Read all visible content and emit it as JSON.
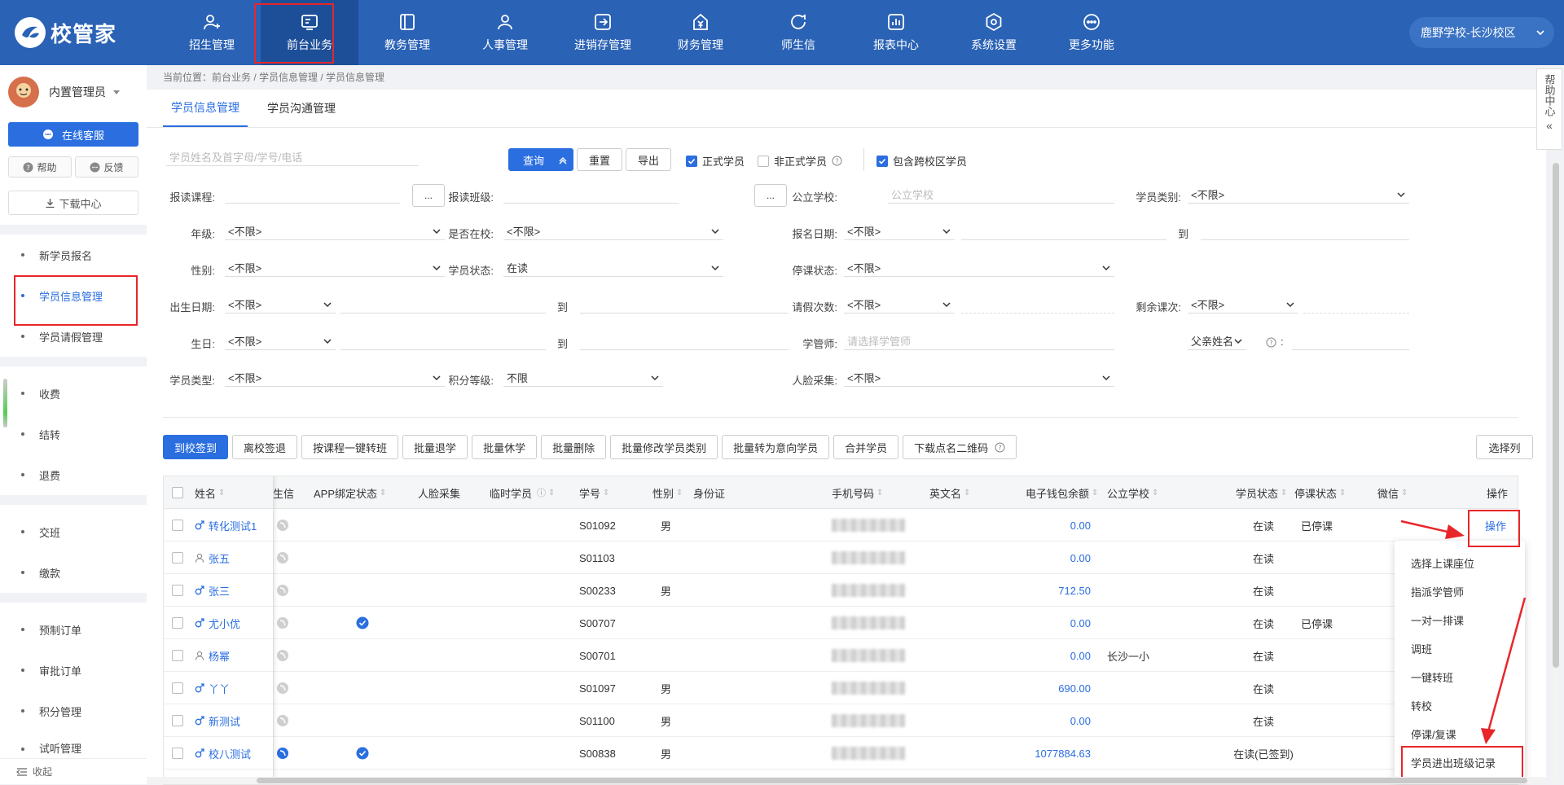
{
  "header": {
    "logo": "校管家",
    "nav": [
      {
        "label": "招生管理",
        "icon": "person-add-icon"
      },
      {
        "label": "前台业务",
        "icon": "frontdesk-icon"
      },
      {
        "label": "教务管理",
        "icon": "book-icon"
      },
      {
        "label": "人事管理",
        "icon": "person-icon"
      },
      {
        "label": "进销存管理",
        "icon": "inventory-icon"
      },
      {
        "label": "财务管理",
        "icon": "finance-icon"
      },
      {
        "label": "师生信",
        "icon": "message-icon"
      },
      {
        "label": "报表中心",
        "icon": "report-icon"
      },
      {
        "label": "系统设置",
        "icon": "settings-icon"
      },
      {
        "label": "更多功能",
        "icon": "more-icon"
      }
    ],
    "active_nav": "前台业务",
    "school": "鹿野学校-长沙校区"
  },
  "sidebar": {
    "user": "内置管理员",
    "service": "在线客服",
    "help": "帮助",
    "feedback": "反馈",
    "download": "下载中心",
    "items": [
      "新学员报名",
      "学员信息管理",
      "学员请假管理",
      "收费",
      "结转",
      "退费",
      "交班",
      "缴款",
      "预制订单",
      "审批订单",
      "积分管理",
      "试听管理"
    ],
    "collapse": "收起"
  },
  "breadcrumb": "当前位置：前台业务 / 学员信息管理 / 学员信息管理",
  "tabs": [
    "学员信息管理",
    "学员沟通管理"
  ],
  "search": {
    "placeholder": "学员姓名及首字母/学号/电话",
    "query": "查询",
    "reset": "重置",
    "export": "导出",
    "formal": "正式学员",
    "informal": "非正式学员",
    "cross_campus": "包含跨校区学员"
  },
  "filters": {
    "course_label": "报读课程:",
    "class_label": "报读班级:",
    "school_label": "公立学校:",
    "school_placeholder": "公立学校",
    "category_label": "学员类别:",
    "grade_label": "年级:",
    "in_school_label": "是否在校:",
    "signup_label": "报名日期:",
    "gender_label": "性别:",
    "status_label": "学员状态:",
    "status_value": "在读",
    "suspend_label": "停课状态:",
    "birthdate_label": "出生日期:",
    "leave_label": "请假次数:",
    "remain_label": "剩余课次:",
    "birthday_label": "生日:",
    "manager_label": "学管师:",
    "manager_placeholder": "请选择学管师",
    "father_label": "父亲姓名",
    "type_label": "学员类型:",
    "points_label": "积分等级:",
    "points_value": "不限",
    "face_label": "人脸采集:",
    "unlimited": "<不限>",
    "to": "到",
    "dots": "...",
    "colon": ":"
  },
  "actions": [
    "到校签到",
    "离校签退",
    "按课程一键转班",
    "批量退学",
    "批量休学",
    "批量删除",
    "批量修改学员类别",
    "批量转为意向学员",
    "合并学员",
    "下载点名二维码"
  ],
  "select_columns": "选择列",
  "table": {
    "headers": [
      "姓名",
      "生信",
      "APP绑定状态",
      "人脸采集",
      "临时学员",
      "学号",
      "性别",
      "身份证",
      "手机号码",
      "英文名",
      "电子钱包余额",
      "公立学校",
      "学员状态",
      "停课状态",
      "微信",
      "操作"
    ],
    "rows": [
      {
        "name": "转化测试1",
        "gender_icon": "male",
        "app": false,
        "id": "S01092",
        "sex": "男",
        "balance": "0.00",
        "school": "",
        "status": "在读",
        "suspend": "已停课"
      },
      {
        "name": "张五",
        "gender_icon": "person",
        "app": false,
        "id": "S01103",
        "sex": "",
        "balance": "0.00",
        "school": "",
        "status": "在读",
        "suspend": ""
      },
      {
        "name": "张三",
        "gender_icon": "male",
        "app": false,
        "id": "S00233",
        "sex": "男",
        "balance": "712.50",
        "school": "",
        "status": "在读",
        "suspend": ""
      },
      {
        "name": "尤小优",
        "gender_icon": "male",
        "app": true,
        "id": "S00707",
        "sex": "",
        "balance": "0.00",
        "school": "",
        "status": "在读",
        "suspend": "已停课"
      },
      {
        "name": "杨幂",
        "gender_icon": "person",
        "app": false,
        "id": "S00701",
        "sex": "",
        "balance": "0.00",
        "school": "长沙一小",
        "status": "在读",
        "suspend": ""
      },
      {
        "name": "丫丫",
        "gender_icon": "male",
        "app": false,
        "id": "S01097",
        "sex": "男",
        "balance": "690.00",
        "school": "",
        "status": "在读",
        "suspend": ""
      },
      {
        "name": "新测试",
        "gender_icon": "male",
        "app": false,
        "id": "S01100",
        "sex": "男",
        "balance": "0.00",
        "school": "",
        "status": "在读",
        "suspend": ""
      },
      {
        "name": "校八测试",
        "gender_icon": "male",
        "app": true,
        "id": "S00838",
        "sex": "男",
        "balance": "1077884.63",
        "school": "",
        "status": "在读(已签到)",
        "suspend": ""
      }
    ],
    "op_label": "操作"
  },
  "op_menu": [
    "选择上课座位",
    "指派学管师",
    "一对一排课",
    "调班",
    "一键转班",
    "转校",
    "停课/复课",
    "学员进出班级记录"
  ],
  "help_side": "帮助中心",
  "colors": {
    "header": "#2a62b5",
    "accent": "#2a6ee0",
    "annotation": "#e8262a"
  }
}
